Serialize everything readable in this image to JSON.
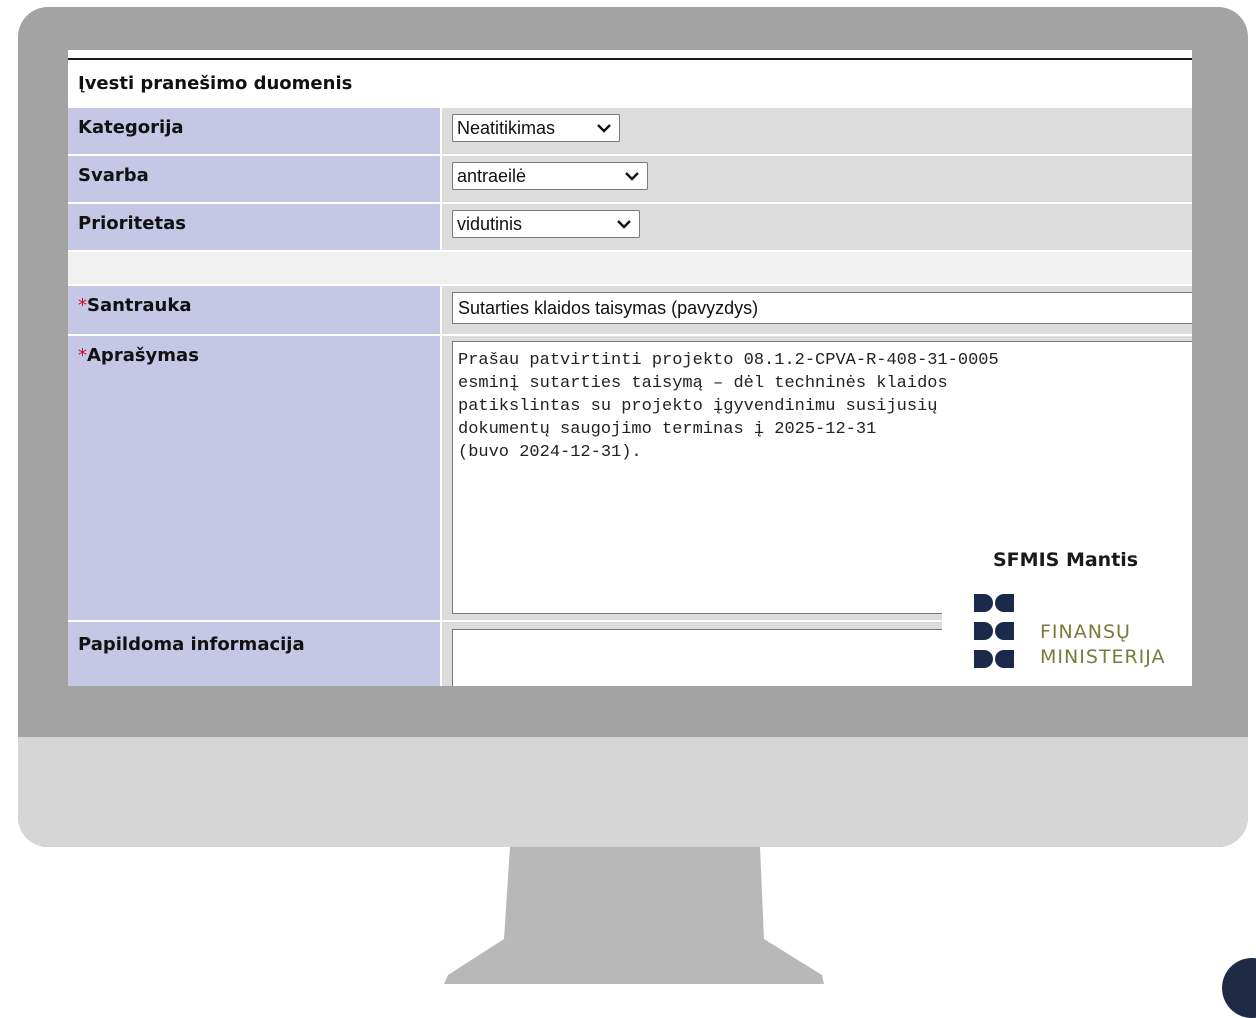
{
  "form": {
    "title": "Įvesti pranešimo duomenis",
    "fields": {
      "category": {
        "label": "Kategorija",
        "value": "Neatitikimas"
      },
      "severity": {
        "label": "Svarba",
        "value": "antraeilė"
      },
      "priority": {
        "label": "Prioritetas",
        "value": "vidutinis"
      },
      "summary": {
        "required_mark": "*",
        "label": "Santrauka",
        "value": "Sutarties klaidos taisymas (pavyzdys)"
      },
      "description": {
        "required_mark": "*",
        "label": "Aprašymas",
        "value": "Prašau patvirtinti projekto 08.1.2-CPVA-R-408-31-0005\nesminį sutarties taisymą – dėl techninės klaidos\npatikslintas su projekto įgyvendinimu susijusių\ndokumentų saugojimo terminas į 2025-12-31\n(buvo 2024-12-31)."
      },
      "additional_info": {
        "label": "Papildoma informacija",
        "value": ""
      }
    }
  },
  "branding": {
    "app_name": "SFMIS Mantis",
    "ministry_line1": "FINANSŲ",
    "ministry_line2": "MINISTERIJA"
  },
  "colors": {
    "label_cell": "#c5c7e5",
    "value_cell": "#dcdcdc",
    "required": "#c8102e",
    "ministry_text": "#7a7a3c",
    "logo_mark": "#1b2a4a",
    "bezel": "#a3a3a3",
    "chin": "#d6d6d6"
  }
}
